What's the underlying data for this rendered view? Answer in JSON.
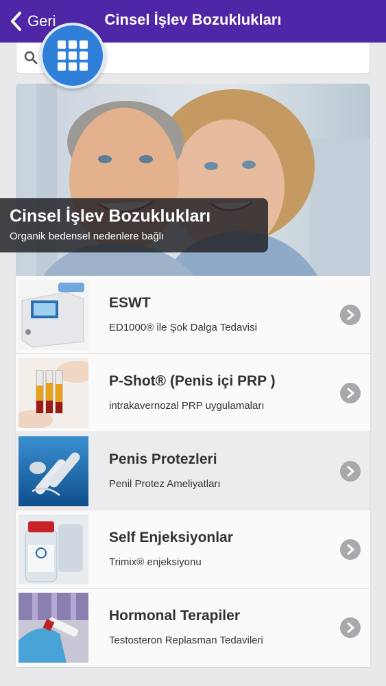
{
  "navbar": {
    "back_label": "Geri",
    "title": "Cinsel İşlev Bozuklukları"
  },
  "search": {
    "value": "",
    "placeholder": ""
  },
  "hero": {
    "title": "Cinsel İşlev Bozuklukları",
    "subtitle": "Organik bedensel nedenlere bağlı"
  },
  "items": [
    {
      "title": "ESWT",
      "subtitle": "ED1000® ile Şok Dalga Tedavisi"
    },
    {
      "title": "P-Shot® (Penis içi PRP )",
      "subtitle": "intrakavernozal PRP uygulamaları"
    },
    {
      "title": "Penis Protezleri",
      "subtitle": "Penil Protez Ameliyatları"
    },
    {
      "title": "Self Enjeksiyonlar",
      "subtitle": "Trimix® enjeksiyonu"
    },
    {
      "title": "Hormonal Terapiler",
      "subtitle": "Testosteron Replasman Tedavileri"
    }
  ],
  "colors": {
    "navbar": "#4f27a6",
    "grid_button": "#2f7fd9",
    "chevron": "#a9a9ad"
  },
  "icons": [
    "chevron-left-icon",
    "search-icon",
    "grid-menu-icon",
    "chevron-right-icon"
  ]
}
